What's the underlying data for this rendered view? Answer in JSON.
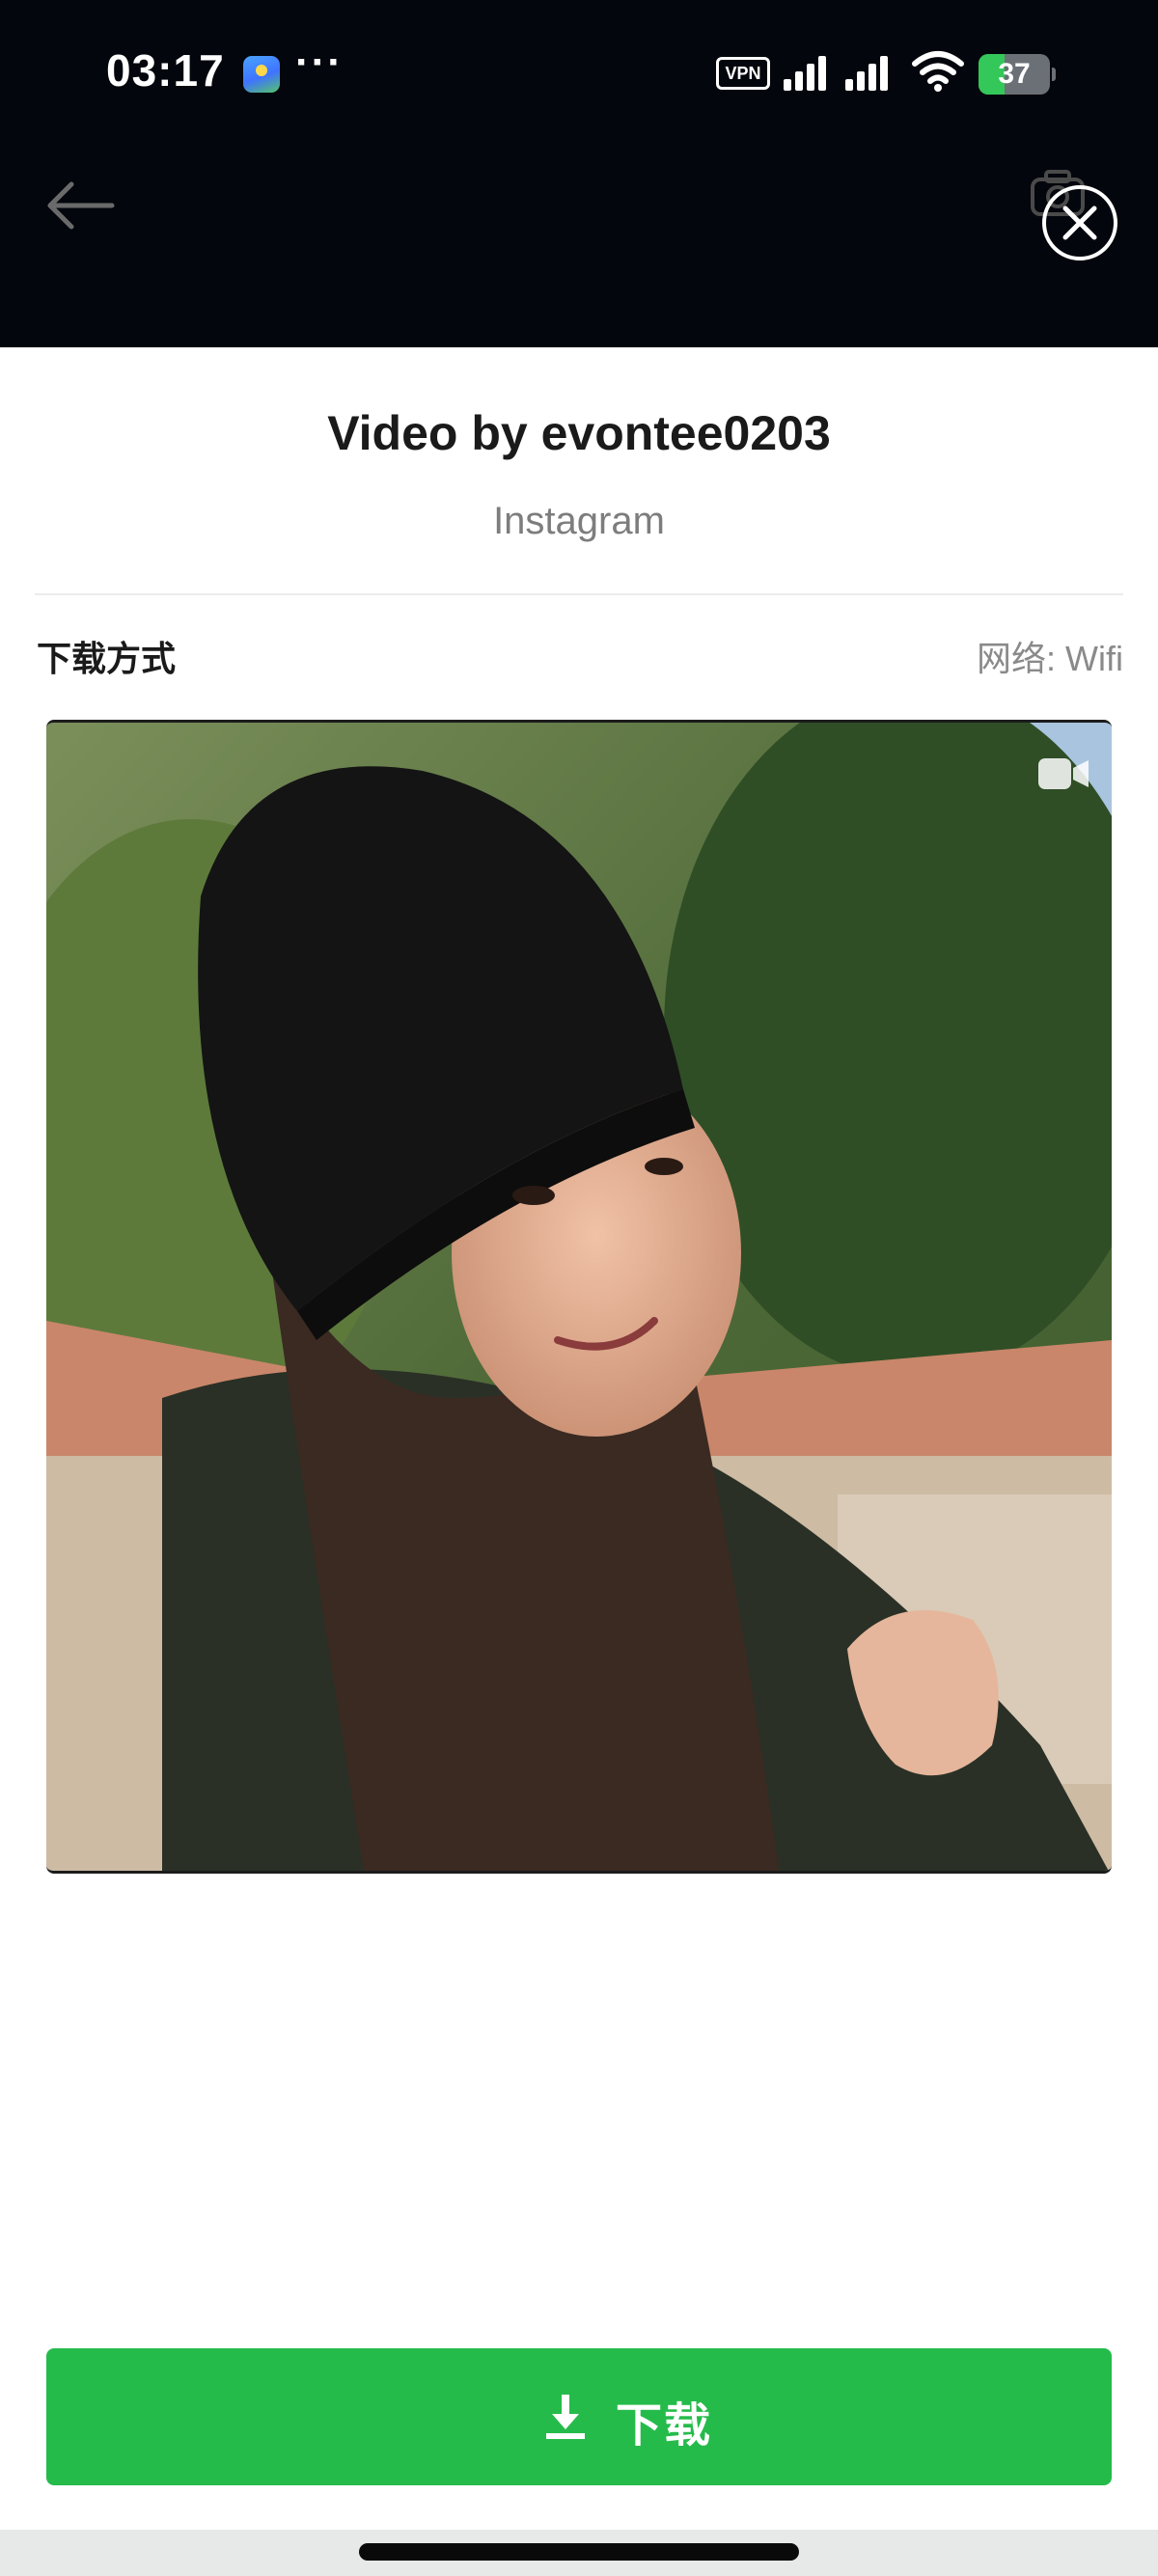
{
  "status_bar": {
    "time": "03:17",
    "more": "···",
    "vpn": "VPN",
    "battery": "37",
    "battery_level": 0.37,
    "colors": {
      "battery_fill": "#34c759"
    }
  },
  "nav": {
    "back_icon": "arrow-left-icon",
    "camera_icon": "camera-icon",
    "close_icon": "close-circle-icon"
  },
  "header": {
    "title": "Video by evontee0203",
    "source": "Instagram"
  },
  "download_section": {
    "method_label": "下载方式",
    "network_label": "网络: Wifi"
  },
  "preview": {
    "type_icon": "video-camera-icon"
  },
  "actions": {
    "download_label": "下载",
    "download_icon": "download-icon",
    "accent": "#25bb4b"
  }
}
